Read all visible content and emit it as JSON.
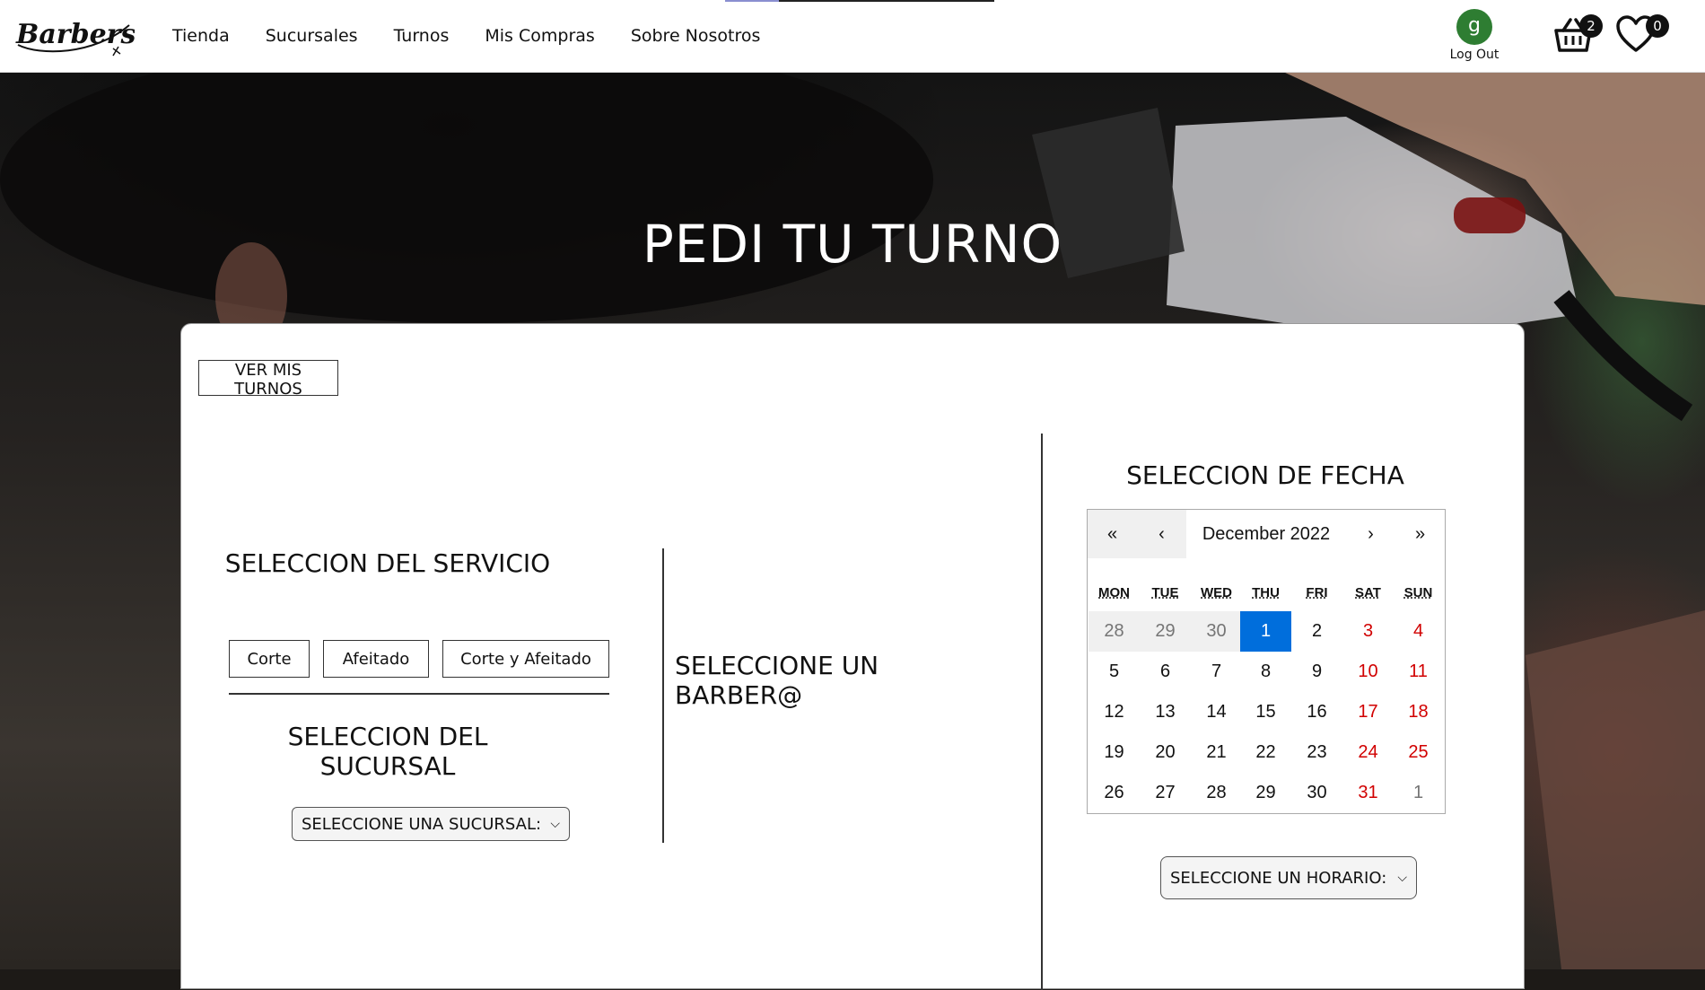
{
  "header": {
    "logo_text": "Barbershop",
    "nav": [
      "Tienda",
      "Sucursales",
      "Turnos",
      "Mis Compras",
      "Sobre Nosotros"
    ],
    "user_initial": "g",
    "logout_label": "Log Out",
    "cart_count": "2",
    "favorites_count": "0"
  },
  "hero": {
    "title": "PEDI TU TURNO"
  },
  "main": {
    "ver_turnos_button": "VER MIS TURNOS",
    "servicio_title": "SELECCION DEL SERVICIO",
    "services": [
      "Corte",
      "Afeitado",
      "Corte y Afeitado"
    ],
    "sucursal_title": "SELECCION DEL SUCURSAL",
    "sucursal_select": "SELECCIONE UNA SUCURSAL:",
    "barber_title": "SELECCIONE UN BARBER@",
    "fecha_title": "SELECCION DE FECHA",
    "horario_select": "SELECCIONE UN HORARIO:"
  },
  "calendar": {
    "month_label": "December 2022",
    "nav": {
      "prev_year": "«",
      "prev_month": "‹",
      "next_month": "›",
      "next_year": "»"
    },
    "weekdays": [
      "MON",
      "TUE",
      "WED",
      "THU",
      "FRI",
      "SAT",
      "SUN"
    ],
    "weeks": [
      [
        "28",
        "29",
        "30",
        "1",
        "2",
        "3",
        "4"
      ],
      [
        "5",
        "6",
        "7",
        "8",
        "9",
        "10",
        "11"
      ],
      [
        "12",
        "13",
        "14",
        "15",
        "16",
        "17",
        "18"
      ],
      [
        "19",
        "20",
        "21",
        "22",
        "23",
        "24",
        "25"
      ],
      [
        "26",
        "27",
        "28",
        "29",
        "30",
        "31",
        "1"
      ]
    ],
    "selected_day": "1",
    "colors": {
      "selected": "#006edc",
      "weekend": "#d10000",
      "other_month": "#757575"
    }
  }
}
